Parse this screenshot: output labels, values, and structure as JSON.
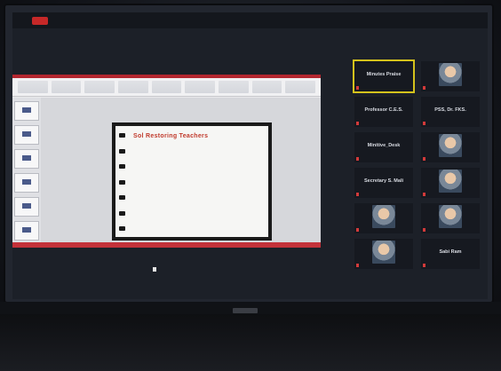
{
  "window": {
    "topbar_text": "",
    "corner_text": "",
    "record_color": "#c62828"
  },
  "presentation": {
    "accent_color": "#b3262f",
    "slide": {
      "title": "Sol Restoring Teachers",
      "paragraphs": [
        "",
        ""
      ]
    },
    "thumbnail_count": 6,
    "ribbon_groups": 9
  },
  "participants": [
    {
      "name": "Minutes Praise",
      "sub": "",
      "active": true,
      "video": false
    },
    {
      "name": "",
      "sub": "",
      "active": false,
      "video": true
    },
    {
      "name": "Professor C.E.S.",
      "sub": "",
      "active": false,
      "video": false
    },
    {
      "name": "PSS, Dr. FKS.",
      "sub": "",
      "active": false,
      "video": false
    },
    {
      "name": "Minitive_Desk",
      "sub": "",
      "active": false,
      "video": false
    },
    {
      "name": "",
      "sub": "",
      "active": false,
      "video": true
    },
    {
      "name": "Secretary S. Mali",
      "sub": "",
      "active": false,
      "video": false
    },
    {
      "name": "",
      "sub": "",
      "active": false,
      "video": true
    },
    {
      "name": "",
      "sub": "",
      "active": false,
      "video": true
    },
    {
      "name": "",
      "sub": "",
      "active": false,
      "video": true
    },
    {
      "name": "",
      "sub": "",
      "active": false,
      "video": true
    },
    {
      "name": "Sabi Ram",
      "sub": "",
      "active": false,
      "video": false
    }
  ]
}
